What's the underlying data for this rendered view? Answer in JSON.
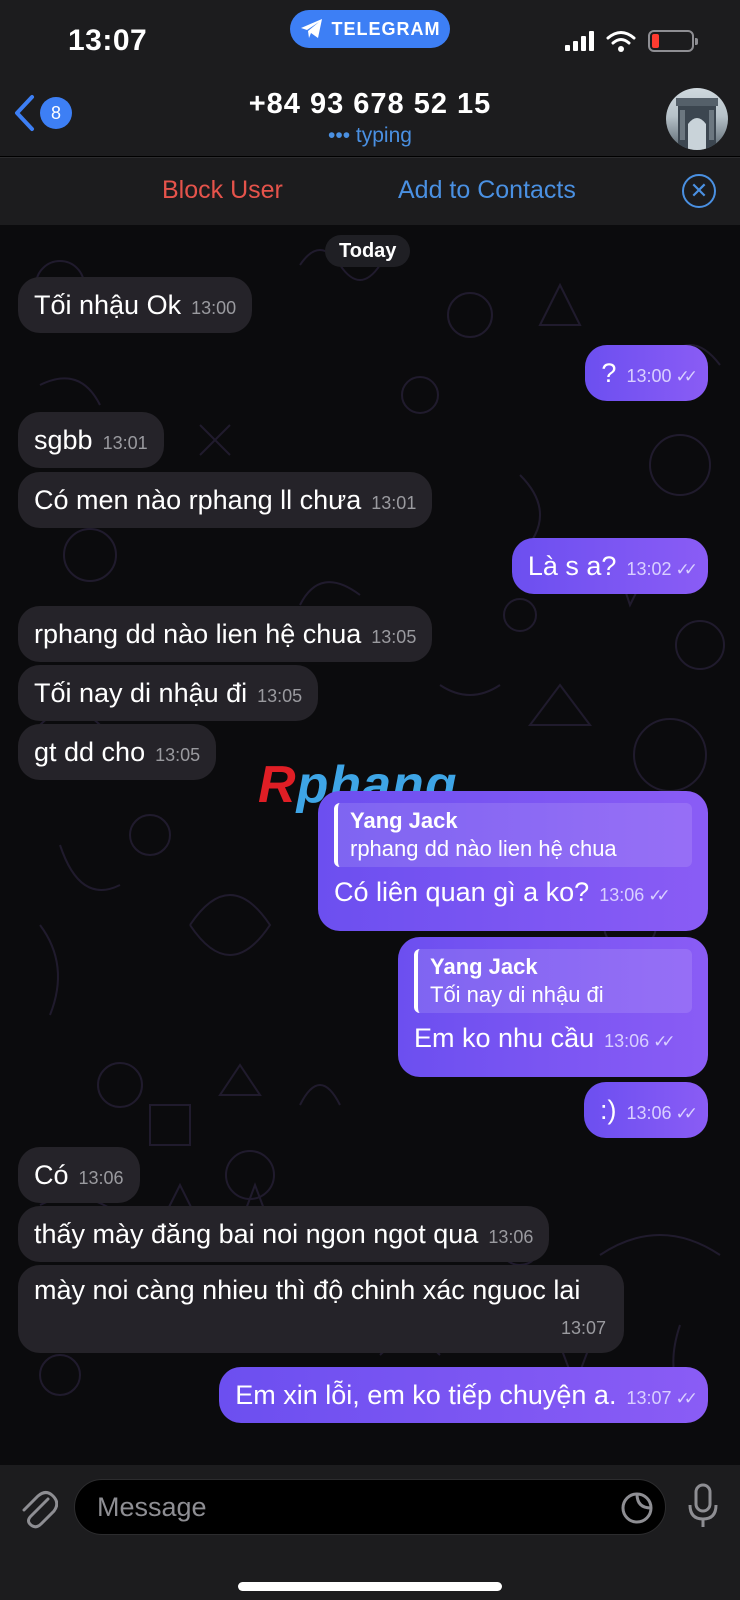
{
  "status": {
    "time": "13:07",
    "app_pill": "TELEGRAM"
  },
  "header": {
    "back_badge": "8",
    "contact": "+84 93 678 52 15",
    "status": "••• typing"
  },
  "actions": {
    "block": "Block User",
    "add": "Add to Contacts"
  },
  "date_divider": "Today",
  "messages": [
    {
      "dir": "in",
      "text": "Tối nhậu Ok",
      "time": "13:00"
    },
    {
      "dir": "out",
      "text": "?",
      "time": "13:00"
    },
    {
      "dir": "in",
      "text": "sgbb",
      "time": "13:01"
    },
    {
      "dir": "in",
      "text": "Có men nào rphang ll chưa",
      "time": "13:01"
    },
    {
      "dir": "out",
      "text": "Là s a?",
      "time": "13:02"
    },
    {
      "dir": "in",
      "text": "rphang dd nào lien hệ chua",
      "time": "13:05"
    },
    {
      "dir": "in",
      "text": "Tối nay di nhậu đi",
      "time": "13:05"
    },
    {
      "dir": "in",
      "text": "gt dd cho",
      "time": "13:05"
    },
    {
      "dir": "out",
      "reply_name": "Yang Jack",
      "reply_text": "rphang dd nào lien hệ chua",
      "text": "Có liên quan gì a ko?",
      "time": "13:06"
    },
    {
      "dir": "out",
      "reply_name": "Yang Jack",
      "reply_text": "Tối nay di nhậu đi",
      "text": "Em ko nhu cầu",
      "time": "13:06"
    },
    {
      "dir": "out",
      "text": ":)",
      "time": "13:06"
    },
    {
      "dir": "in",
      "text": "Có",
      "time": "13:06"
    },
    {
      "dir": "in",
      "text": "thấy mày đăng bai noi ngon ngot qua",
      "time": "13:06"
    },
    {
      "dir": "in",
      "text": "mày noi càng nhieu thì độ chinh xác nguoc lai",
      "time": "13:07"
    },
    {
      "dir": "out",
      "text": "Em xin lỗi, em ko tiếp chuyện a.",
      "time": "13:07"
    }
  ],
  "watermark": {
    "first": "R",
    "rest": "phang"
  },
  "input": {
    "placeholder": "Message"
  },
  "icons": {
    "back": "chevron-left-icon",
    "pill": "telegram-plane-icon",
    "signal": "signal-icon",
    "wifi": "wifi-icon",
    "battery": "battery-icon",
    "close": "close-circle-icon",
    "attach": "paperclip-icon",
    "sticker": "sticker-icon",
    "mic": "microphone-icon"
  },
  "colors": {
    "accent": "#3d7ff5",
    "outgoing": "#7b56f3",
    "incoming": "#252329",
    "danger": "#e5534b",
    "link": "#4a90e2"
  }
}
